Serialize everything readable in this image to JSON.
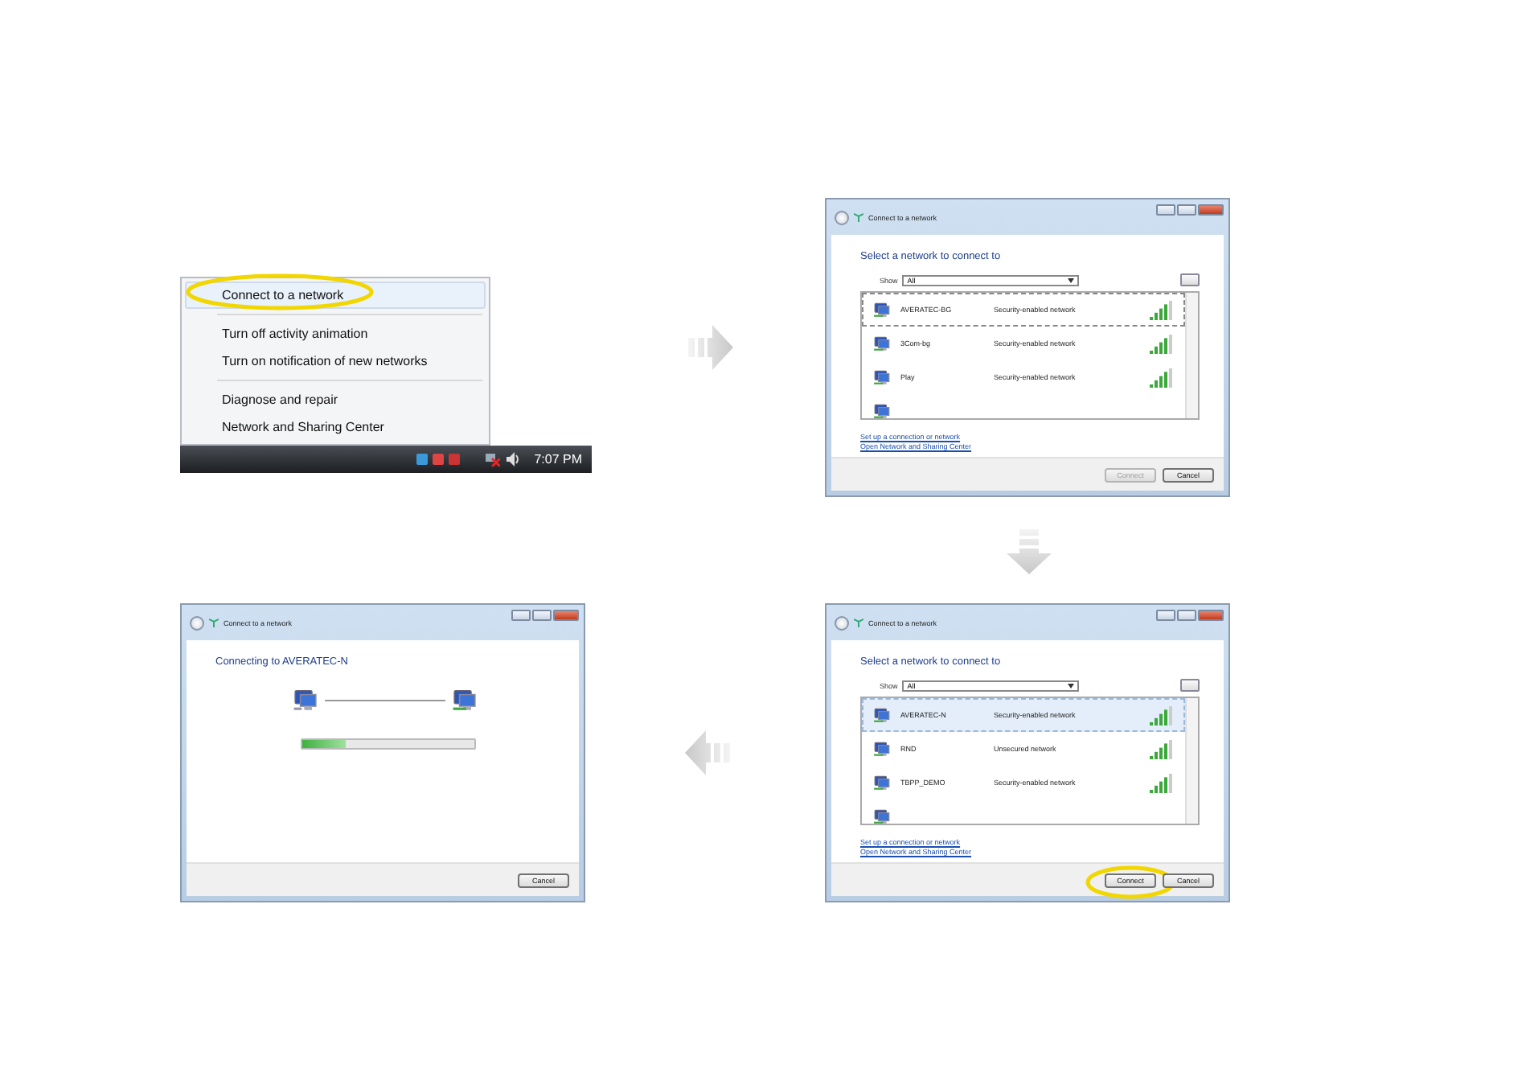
{
  "tray_menu": {
    "groups": [
      [
        {
          "label": "Connect to a network",
          "highlighted": true,
          "circled": true
        }
      ],
      [
        {
          "label": "Turn off activity animation",
          "highlighted": false,
          "circled": false
        },
        {
          "label": "Turn on notification of new networks",
          "highlighted": false,
          "circled": false
        }
      ],
      [
        {
          "label": "Diagnose and repair",
          "highlighted": false,
          "circled": false
        },
        {
          "label": "Network and Sharing Center",
          "highlighted": false,
          "circled": false
        }
      ]
    ],
    "clock": "7:07 PM"
  },
  "arrows": [
    {
      "kind": "right"
    },
    {
      "kind": "down"
    },
    {
      "kind": "left"
    }
  ],
  "windows": [
    {
      "kind": "network_list",
      "title": "Connect to a network",
      "heading": "Select a network to connect to",
      "show_label": "Show",
      "show_value": "All",
      "networks": [
        {
          "name": "AVERATEC-BG",
          "security": "Security-enabled network",
          "selected": false,
          "focused": true
        },
        {
          "name": "3Com-bg",
          "security": "Security-enabled network",
          "selected": false,
          "focused": false
        },
        {
          "name": "Play",
          "security": "Security-enabled network",
          "selected": false,
          "focused": false
        }
      ],
      "links": [
        "Set up a connection or network",
        "Open Network and Sharing Center"
      ],
      "buttons": [
        {
          "label": "Connect",
          "disabled": true,
          "circled": false
        },
        {
          "label": "Cancel",
          "disabled": false,
          "circled": false
        }
      ]
    },
    {
      "kind": "connecting",
      "title": "Connect to a network",
      "heading": "Connecting to AVERATEC-N",
      "level": 0.25,
      "buttons": [
        {
          "label": "Cancel",
          "disabled": false,
          "circled": false
        }
      ]
    },
    {
      "kind": "network_list",
      "title": "Connect to a network",
      "heading": "Select a network to connect to",
      "show_label": "Show",
      "show_value": "All",
      "networks": [
        {
          "name": "AVERATEC-N",
          "security": "Security-enabled network",
          "selected": true,
          "focused": true
        },
        {
          "name": "RND",
          "security": "Unsecured network",
          "selected": false,
          "focused": false
        },
        {
          "name": "TBPP_DEMO",
          "security": "Security-enabled network",
          "selected": false,
          "focused": false
        }
      ],
      "links": [
        "Set up a connection or network",
        "Open Network and Sharing Center"
      ],
      "buttons": [
        {
          "label": "Connect",
          "disabled": false,
          "circled": true
        },
        {
          "label": "Cancel",
          "disabled": false,
          "circled": false
        }
      ]
    }
  ]
}
